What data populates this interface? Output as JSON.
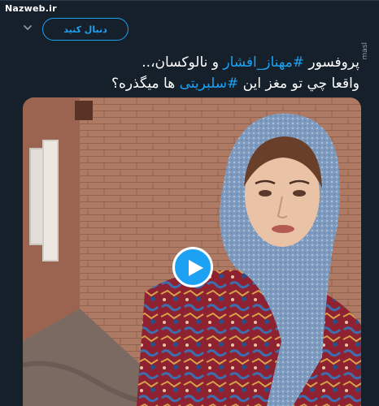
{
  "watermark": "Nazweb.ir",
  "header": {
    "follow_label": "دنبال کنید",
    "chevron_icon": "chevron-down-icon"
  },
  "tweet": {
    "line1_prefix": "پروفسور ",
    "line1_hashtag": "#مهناز_افشار",
    "line1_suffix": " و نالوکسان،..",
    "line2_prefix": "واقعا چي تو مغز اين ",
    "line2_hashtag": "#سلبريتی",
    "line2_suffix": " ها ميگذره؟"
  },
  "side_label": "masl",
  "media": {
    "type": "video",
    "play_icon": "play-icon"
  },
  "colors": {
    "background": "#15202b",
    "accent": "#1da1f2",
    "text": "#ffffff"
  }
}
